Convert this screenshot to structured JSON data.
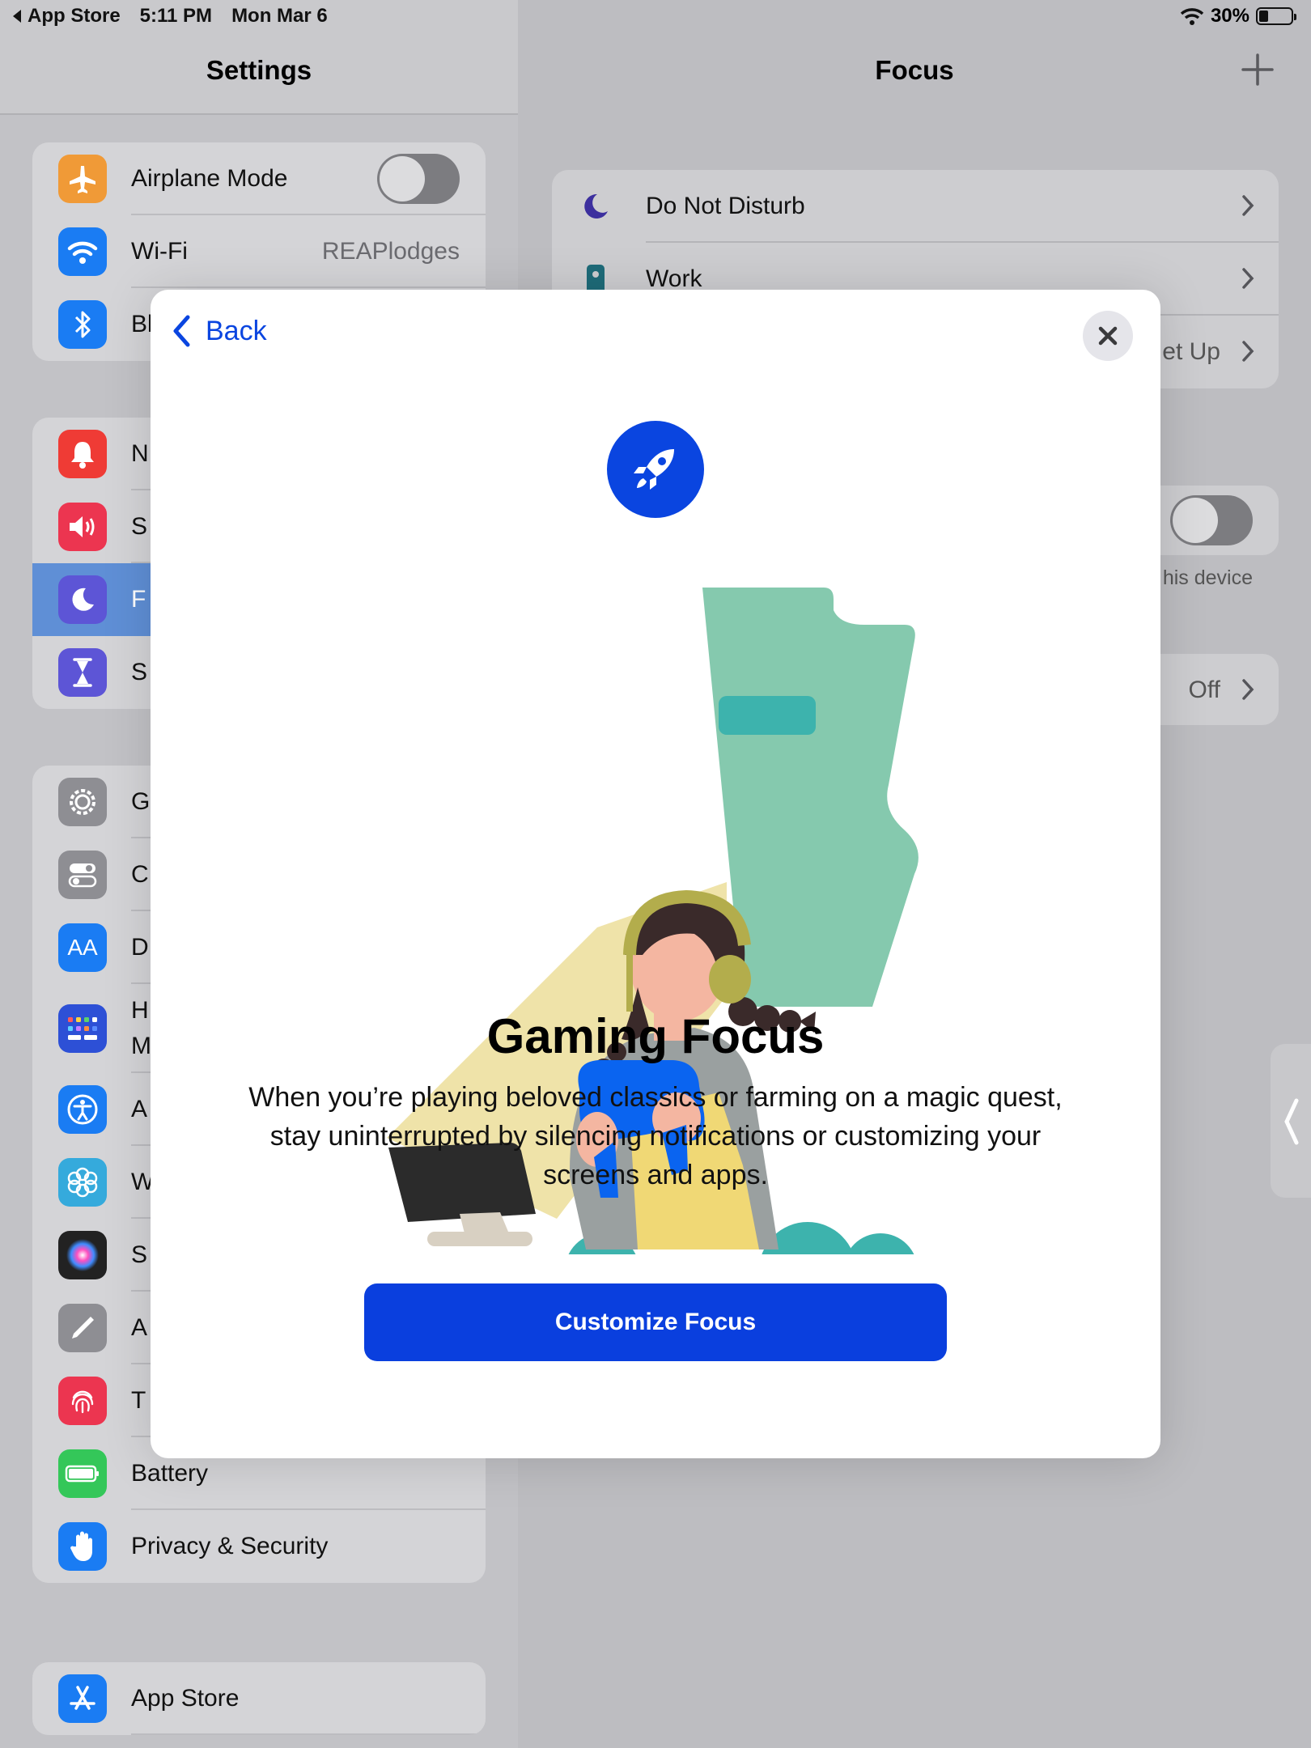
{
  "status_bar": {
    "back_app": "App Store",
    "time": "5:11 PM",
    "date": "Mon Mar 6",
    "battery": "30%",
    "battery_level": 0.3
  },
  "settings": {
    "title": "Settings",
    "groups": [
      {
        "items": [
          {
            "label": "Airplane Mode",
            "icon": "airplane-icon",
            "color": "#f09a37",
            "toggle": false
          },
          {
            "label": "Wi-Fi",
            "icon": "wifi-icon",
            "color": "#1a7cf3",
            "value": "REAPlodges"
          },
          {
            "label": "Bl",
            "icon": "bluetooth-icon",
            "color": "#1a7cf3"
          }
        ]
      },
      {
        "items": [
          {
            "label": "N",
            "icon": "notifications-icon",
            "color": "#ef3b35"
          },
          {
            "label": "S",
            "icon": "sounds-icon",
            "color": "#ec3550"
          },
          {
            "label": "F",
            "icon": "focus-moon-icon",
            "color": "#5d55d6",
            "selected": true
          },
          {
            "label": "S",
            "icon": "screen-time-icon",
            "color": "#5d55d6"
          }
        ]
      },
      {
        "items": [
          {
            "label": "G",
            "icon": "general-gear-icon",
            "color": "#8e8e93"
          },
          {
            "label": "C",
            "icon": "control-center-icon",
            "color": "#8e8e93"
          },
          {
            "label": "D",
            "icon": "display-aa-icon",
            "color": "#1a7cf3"
          },
          {
            "label": "H",
            "label2": "M",
            "icon": "home-screen-icon",
            "color": "#2d50d6"
          },
          {
            "label": "A",
            "icon": "accessibility-icon",
            "color": "#1a7cf3"
          },
          {
            "label": "W",
            "icon": "wallpaper-icon",
            "color": "#35aadc"
          },
          {
            "label": "S",
            "icon": "siri-icon",
            "color": "#222"
          },
          {
            "label": "A",
            "icon": "pencil-icon",
            "color": "#8e8e93"
          },
          {
            "label": "T",
            "icon": "touch-id-icon",
            "color": "#ec3550"
          },
          {
            "label": "Battery",
            "icon": "battery-icon",
            "color": "#34c759"
          },
          {
            "label": "Privacy & Security",
            "icon": "privacy-hand-icon",
            "color": "#1a7cf3"
          }
        ]
      },
      {
        "items": [
          {
            "label": "App Store",
            "icon": "app-store-icon",
            "color": "#1a7cf3"
          }
        ]
      }
    ]
  },
  "focus": {
    "title": "Focus",
    "items": [
      {
        "label": "Do Not Disturb",
        "icon": "moon-icon"
      },
      {
        "label": "Work",
        "icon": "work-badge-icon"
      },
      {
        "label": "et Up",
        "icon": ""
      }
    ],
    "partial_device_text": "his device",
    "off_value": "Off"
  },
  "modal": {
    "back_label": "Back",
    "title": "Gaming Focus",
    "description": "When you’re playing beloved classics or farming on a magic quest, stay uninterrupted by silencing notifications or customizing your screens and apps.",
    "button_label": "Customize Focus",
    "accent": "#0a45e0"
  }
}
